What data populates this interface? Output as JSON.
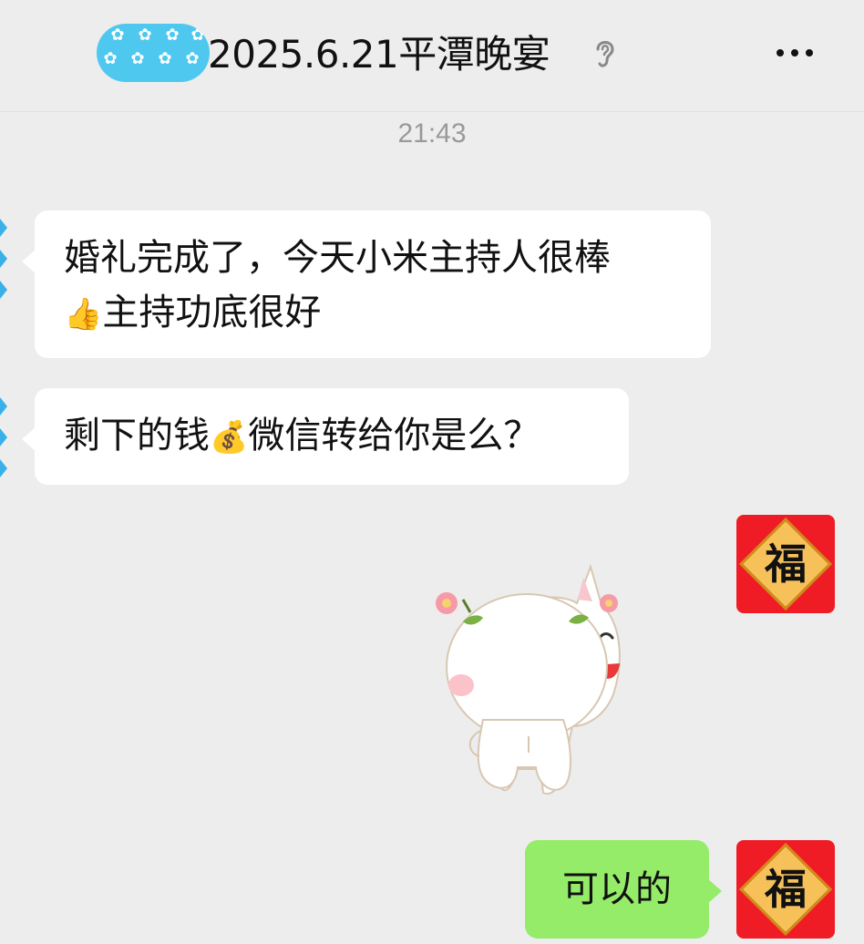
{
  "header": {
    "title": "2025.6.21平潭晚宴",
    "avatar_icon": "flower-pattern-avatar",
    "muted_icon": "ear-icon",
    "more_icon": "more-icon"
  },
  "chat": {
    "timestamp": "21:43",
    "messages": [
      {
        "side": "left",
        "line1": "婚礼完成了，今天小米主持人很棒",
        "line2": "主持功底很好",
        "line2_emoji": "👍"
      },
      {
        "side": "left",
        "text_before": "剩下的钱",
        "emoji": "💰",
        "text_after": "微信转给你是么？"
      },
      {
        "side": "right",
        "type": "sticker",
        "sticker_icon": "cartoon-cats-hugging-sticker"
      },
      {
        "side": "right",
        "text": "可以的"
      }
    ],
    "self_avatar_char": "福"
  },
  "colors": {
    "background": "#ededed",
    "bubble_other": "#ffffff",
    "bubble_self": "#95ec69",
    "avatar_red": "#ef1c25",
    "avatar_gold": "#f7c15a"
  }
}
